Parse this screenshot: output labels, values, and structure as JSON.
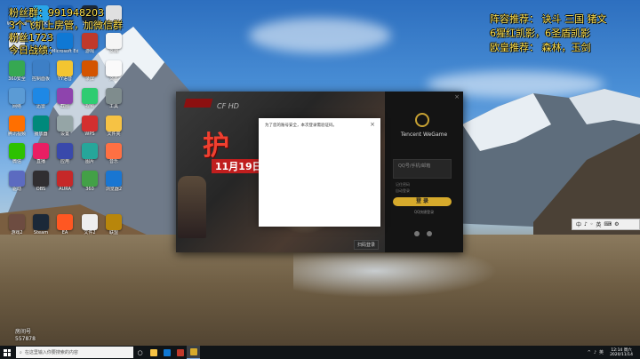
{
  "overlay": {
    "left_lines": [
      "粉丝群：9919482​03",
      "3个飞机上房管，加微信群",
      "粉丝1723",
      "今日战绩："
    ],
    "right_lines": [
      "阵容推荐：  诀斗  三国  猪文",
      "6猩红凯影，6圣盾凯影",
      "欧皇推荐：  森林，玉剑"
    ]
  },
  "desktop_icons": [
    {
      "label": "WeGame",
      "color": "#2b7bd6"
    },
    {
      "label": "腾讯QQ",
      "color": "#29a6e8"
    },
    {
      "label": "浏览器",
      "color": "#1a5fb4"
    },
    {
      "label": "Steam",
      "color": "#1b2838"
    },
    {
      "label": "文件",
      "color": "#e0e0e0"
    },
    {
      "label": "回收站",
      "color": "#dfe6ee"
    },
    {
      "label": "计算机",
      "color": "#4a8bd4"
    },
    {
      "label": "Microsoft Edge",
      "color": "#0f78d4"
    },
    {
      "label": "游戏",
      "color": "#c0392b"
    },
    {
      "label": "文档",
      "color": "#f5f5f5"
    },
    {
      "label": "360安全",
      "color": "#36a852"
    },
    {
      "label": "控制面板",
      "color": "#3d7fc6"
    },
    {
      "label": "YY语音",
      "color": "#f3c531"
    },
    {
      "label": "录屏",
      "color": "#d35400"
    },
    {
      "label": "文本",
      "color": "#fafafa"
    },
    {
      "label": "网络",
      "color": "#5b9bd5"
    },
    {
      "label": "迅雷",
      "color": "#1e88e5"
    },
    {
      "label": "截图",
      "color": "#8e44ad"
    },
    {
      "label": "视频",
      "color": "#2ecc71"
    },
    {
      "label": "工具",
      "color": "#7f8c8d"
    },
    {
      "label": "腾讯视频",
      "color": "#ff6f00"
    },
    {
      "label": "播放器",
      "color": "#00897b"
    },
    {
      "label": "设置",
      "color": "#95a5a6"
    },
    {
      "label": "WPS",
      "color": "#d32f2f"
    },
    {
      "label": "文件夹",
      "color": "#f6c244"
    },
    {
      "label": "微信",
      "color": "#2dc100"
    },
    {
      "label": "直播",
      "color": "#e91e63"
    },
    {
      "label": "应用",
      "color": "#3949ab"
    },
    {
      "label": "图片",
      "color": "#26a69a"
    },
    {
      "label": "音乐",
      "color": "#ff7043"
    },
    {
      "label": "驱动",
      "color": "#5c6bc0"
    },
    {
      "label": "OBS",
      "color": "#302e31"
    },
    {
      "label": "AURA",
      "color": "#c62828"
    },
    {
      "label": "360",
      "color": "#43a047"
    },
    {
      "label": "浏览器2",
      "color": "#1976d2"
    },
    {
      "label": "游戏2",
      "color": "#6d4c41"
    },
    {
      "label": "Steam",
      "color": "#1b2838"
    },
    {
      "label": "EA",
      "color": "#ff5722"
    },
    {
      "label": "文件2",
      "color": "#eeeeee"
    },
    {
      "label": "联盟",
      "color": "#b8860b"
    }
  ],
  "launcher": {
    "brand": "CF HD",
    "banner_headline": "护",
    "banner_date": "11月19日",
    "side_brand": "Tencent WeGame",
    "account_placeholder": "QQ号/手机/邮箱",
    "option_remember": "记住密码",
    "option_auto": "自动登录",
    "login_label": "登 录",
    "qr_label": "QQ快捷登录",
    "scan_label": "扫码登录",
    "close_glyph": "×"
  },
  "modal": {
    "message": "为了您的账号安全，本次登录需验证码。",
    "close_glyph": "×"
  },
  "langbar": {
    "items": [
      "中",
      "♪",
      "◦",
      "英",
      "⌨",
      "⚙"
    ]
  },
  "room": {
    "label": "房间号",
    "number": "557878"
  },
  "taskbar": {
    "search_placeholder": "在这里输入你要搜索的内容",
    "clock_time": "12:14 周六",
    "clock_date": "2020/11/14",
    "tray": [
      "^",
      "♪",
      "英"
    ]
  }
}
